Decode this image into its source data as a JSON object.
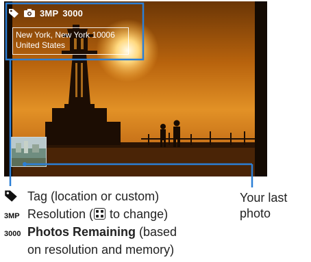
{
  "viewfinder": {
    "status_bar": {
      "tag_icon": "tag-icon",
      "camera_icon": "camera-icon",
      "resolution": "3MP",
      "photos_remaining": "3000"
    },
    "location": {
      "line1": "New York, New York 10006",
      "line2": "United States"
    },
    "last_photo_thumbnail": "last-photo-thumbnail"
  },
  "legend": {
    "tag": {
      "icon": "tag-icon",
      "label": "Tag (location or custom)"
    },
    "resolution": {
      "key": "3MP",
      "before": "Resolution (",
      "after": " to change)"
    },
    "photos_remaining": {
      "key": "3000",
      "bold": "Photos Remaining",
      "rest": " (based",
      "line2": "on resolution and memory)"
    }
  },
  "last_photo_caption": {
    "line1": "Your last",
    "line2": "photo"
  },
  "colors": {
    "callout": "#2b7fd6",
    "sky": "#e08a1e",
    "text": "#222222"
  }
}
